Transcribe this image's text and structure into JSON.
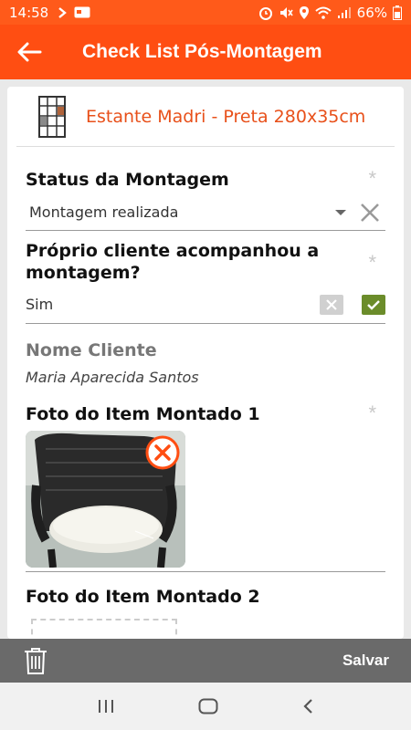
{
  "status_bar": {
    "time": "14:58",
    "battery": "66%"
  },
  "app_bar": {
    "title": "Check List Pós-Montagem"
  },
  "product": {
    "name": "Estante Madri - Preta 280x35cm"
  },
  "fields": {
    "status": {
      "label": "Status da Montagem",
      "value": "Montagem realizada",
      "required": "*"
    },
    "accompanied": {
      "label": "Próprio cliente acompanhou a montagem?",
      "value": "Sim",
      "required": "*"
    },
    "client_name": {
      "label": "Nome Cliente",
      "value": "Maria Aparecida Santos"
    },
    "photo1": {
      "label": "Foto do Item Montado 1",
      "required": "*"
    },
    "photo2": {
      "label": "Foto do Item Montado 2"
    }
  },
  "bottom_bar": {
    "save_label": "Salvar"
  },
  "colors": {
    "accent": "#ff4e12",
    "product_name": "#e8501a",
    "check_green": "#6b8c2a",
    "bottom_bar": "#6a6a6a"
  },
  "icons": [
    "back-arrow-icon",
    "trash-icon",
    "close-circle-icon",
    "dropdown-icon",
    "clear-x-icon",
    "check-icon",
    "nav-recent-icon",
    "nav-home-icon",
    "nav-back-icon"
  ]
}
